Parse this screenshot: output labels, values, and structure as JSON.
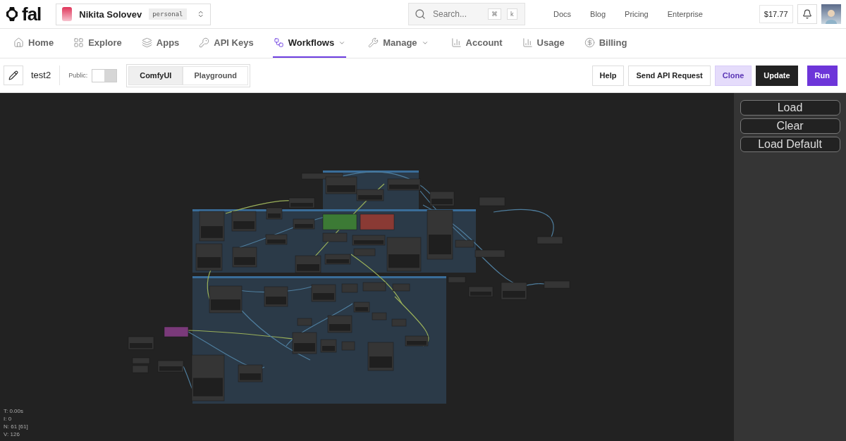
{
  "header": {
    "brand": "fal",
    "account": {
      "name": "Nikita Solovev",
      "badge": "personal"
    },
    "search": {
      "placeholder": "Search...",
      "keys": [
        "⌘",
        "k"
      ]
    },
    "links": [
      "Docs",
      "Blog",
      "Pricing",
      "Enterprise"
    ],
    "balance": "$17.77"
  },
  "nav": [
    {
      "label": "Home",
      "selected": false,
      "menu": false
    },
    {
      "label": "Explore",
      "selected": false,
      "menu": false
    },
    {
      "label": "Apps",
      "selected": false,
      "menu": false
    },
    {
      "label": "API Keys",
      "selected": false,
      "menu": false
    },
    {
      "label": "Workflows",
      "selected": true,
      "menu": true
    },
    {
      "label": "Manage",
      "selected": false,
      "menu": true
    },
    {
      "label": "Account",
      "selected": false,
      "menu": false
    },
    {
      "label": "Usage",
      "selected": false,
      "menu": false
    },
    {
      "label": "Billing",
      "selected": false,
      "menu": false
    }
  ],
  "toolbar": {
    "name": "test2",
    "public_label": "Public:",
    "public_on": false,
    "tabs": [
      {
        "label": "ComfyUI",
        "selected": true
      },
      {
        "label": "Playground",
        "selected": false
      }
    ],
    "buttons": [
      {
        "label": "Help",
        "kind": "plain"
      },
      {
        "label": "Send API Request",
        "kind": "plain"
      },
      {
        "label": "Clone",
        "kind": "soft"
      },
      {
        "label": "Update",
        "kind": "dark"
      },
      {
        "label": "Run",
        "kind": "primary"
      }
    ]
  },
  "side_panel": {
    "buttons": [
      "Load",
      "Clear",
      "Load Default"
    ]
  },
  "stats": [
    "T: 0.00s",
    "I: 0",
    "N: 61 [61]",
    "V: 126"
  ]
}
